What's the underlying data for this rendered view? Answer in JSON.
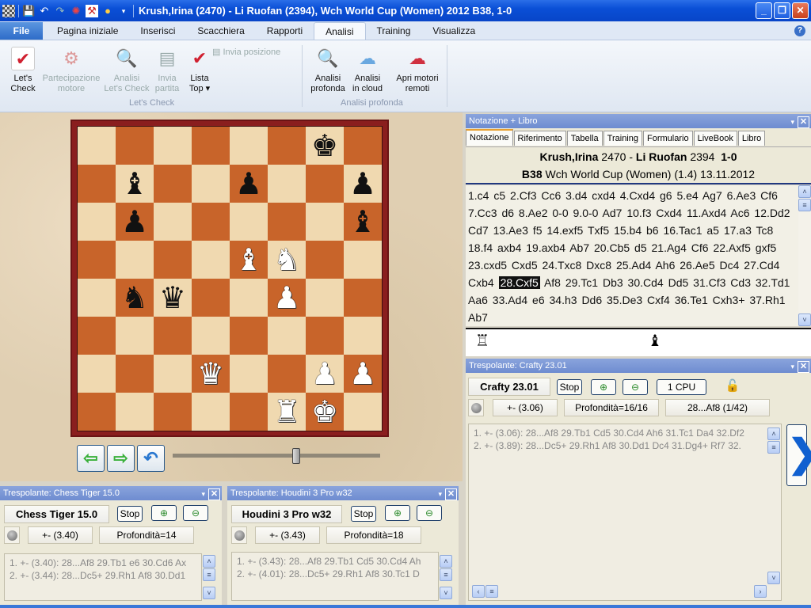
{
  "window": {
    "title": "Krush,Irina (2470) - Li Ruofan (2394), Wch World Cup (Women) 2012  B38, 1-0",
    "quick_access": [
      "board-icon",
      "save-icon",
      "undo-icon",
      "redo-icon",
      "chess-engine-icon",
      "tool-icon",
      "lightbulb-icon",
      "dropdown-icon"
    ],
    "controls": {
      "minimize": "_",
      "restore": "❐",
      "close": "✕"
    }
  },
  "menu": {
    "file": "File",
    "tabs": [
      "Pagina iniziale",
      "Inserisci",
      "Scacchiera",
      "Rapporti",
      "Analisi",
      "Training",
      "Visualizza"
    ],
    "active_tab": "Analisi",
    "help": "?"
  },
  "ribbon": {
    "lets_check_group": {
      "label": "Let's Check",
      "buttons": [
        {
          "label1": "Let's",
          "label2": "Check",
          "icon": "✔",
          "enabled": true
        },
        {
          "label1": "Partecipazione",
          "label2": "motore",
          "icon": "⚙",
          "enabled": false
        },
        {
          "label1": "Analisi",
          "label2": "Let's Check",
          "icon": "🔍",
          "enabled": false
        },
        {
          "label1": "Invia",
          "label2": "partita",
          "icon": "▤",
          "enabled": false
        },
        {
          "label1": "Lista",
          "label2": "Top ▾",
          "icon": "✔",
          "enabled": true
        }
      ],
      "small_button": "Invia posizione"
    },
    "deep_group": {
      "label": "Analisi profonda",
      "buttons": [
        {
          "label1": "Analisi",
          "label2": "profonda",
          "icon": "🔍"
        },
        {
          "label1": "Analisi",
          "label2": "in cloud",
          "icon": "☁"
        },
        {
          "label1": "Apri motori",
          "label2": "remoti",
          "icon": "☁"
        }
      ]
    }
  },
  "board": {
    "position_rows": [
      [
        "",
        "",
        "",
        "",
        "",
        "",
        "bk",
        ""
      ],
      [
        "",
        "bb",
        "",
        "",
        "bp",
        "",
        "",
        "bp"
      ],
      [
        "",
        "bp",
        "",
        "",
        "",
        "",
        "",
        "bb"
      ],
      [
        "",
        "",
        "",
        "",
        "wb",
        "wn",
        "",
        ""
      ],
      [
        "",
        "bn",
        "bq",
        "",
        "",
        "wp",
        "",
        ""
      ],
      [
        "",
        "",
        "",
        "",
        "",
        "",
        "",
        ""
      ],
      [
        "",
        "",
        "",
        "wq",
        "",
        "",
        "wp",
        "wp"
      ],
      [
        "",
        "",
        "",
        "",
        "",
        "wr",
        "wk",
        ""
      ]
    ],
    "glyphs": {
      "k": "♚",
      "q": "♛",
      "r": "♜",
      "b": "♝",
      "n": "♞",
      "p": "♟"
    },
    "slider_position_fraction": 0.58
  },
  "nav": {
    "back": "⇦",
    "forward": "⇨",
    "undo": "↶"
  },
  "notation_panel": {
    "title": "Notazione + Libro",
    "tabs": [
      "Notazione",
      "Riferimento",
      "Tabella",
      "Training",
      "Formulario",
      "LiveBook",
      "Libro"
    ],
    "active_tab": "Notazione",
    "white": "Krush,Irina",
    "white_elo": "2470",
    "black": "Li Ruofan",
    "black_elo": "2394",
    "result": "1-0",
    "eco": "B38",
    "event": "Wch World Cup (Women) (1.4) 13.11.2012",
    "moves_before": "1.c4  c5  2.Cf3  Cc6  3.d4  cxd4  4.Cxd4  g6  5.e4  Ag7  6.Ae3  Cf6  7.Cc3  d6  8.Ae2  0-0  9.0-0  Ad7  10.f3  Cxd4  11.Axd4  Ac6  12.Dd2  Cd7  13.Ae3  f5  14.exf5  Txf5  15.b4  b6  16.Tac1  a5  17.a3  Tc8  18.f4  axb4  19.axb4  Ab7  20.Cb5  d5  21.Ag4  Cf6  22.Axf5  gxf5  23.cxd5  Cxd5  24.Txc8  Dxc8  25.Ad4  Ah6  26.Ae5  Dc4  27.Cd4  Cxb4 ",
    "current_move": "28.Cxf5",
    "moves_after": " Af8  29.Tc1  Db3  30.Cd4  Dd5  31.Cf3  Cd3  32.Td1  Aa6  33.Ad4  e6  34.h3  Dd6  35.De3  Cxf4  36.Te1  Cxh3+  37.Rh1  Ab7",
    "captured": {
      "white": "♖",
      "black": "♝"
    }
  },
  "engines": {
    "crafty": {
      "title": "Trespolante: Crafty 23.01",
      "name": "Crafty 23.01",
      "stop": "Stop",
      "cpu": "1 CPU",
      "eval": "+-  (3.06)",
      "depth": "Profondità=16/16",
      "move": "28...Af8 (1/42)",
      "lines": [
        "1. +-  (3.06): 28...Af8 29.Tb1 Cd5 30.Cd4 Ah6 31.Tc1 Da4 32.Df2",
        "2. +-  (3.89): 28...Dc5+ 29.Rh1 Af8 30.Dd1 Dc4 31.Dg4+ Rf7 32."
      ],
      "next": "❯"
    },
    "tiger": {
      "title": "Trespolante: Chess Tiger 15.0",
      "name": "Chess Tiger 15.0",
      "stop": "Stop",
      "eval": "+-  (3.40)",
      "depth": "Profondità=14",
      "lines": [
        "1. +-  (3.40): 28...Af8 29.Tb1 e6 30.Cd6 Ax",
        "2. +-  (3.44): 28...Dc5+ 29.Rh1 Af8 30.Dd1"
      ]
    },
    "houdini": {
      "title": "Trespolante: Houdini 3 Pro w32",
      "name": "Houdini 3 Pro w32",
      "stop": "Stop",
      "eval": "+-  (3.43)",
      "depth": "Profondità=18",
      "lines": [
        "1. +-  (3.43): 28...Af8 29.Tb1 Cd5 30.Cd4 Ah",
        "2. +-  (4.01): 28...Dc5+ 29.Rh1 Af8 30.Tc1 D"
      ]
    }
  },
  "icons": {
    "zoom_in": "⊕",
    "zoom_out": "⊖",
    "lock": "🔓",
    "dropdown": "▾",
    "close": "✕",
    "up": "˄",
    "down": "˅",
    "left": "‹",
    "right": "›",
    "grip": "≡"
  }
}
